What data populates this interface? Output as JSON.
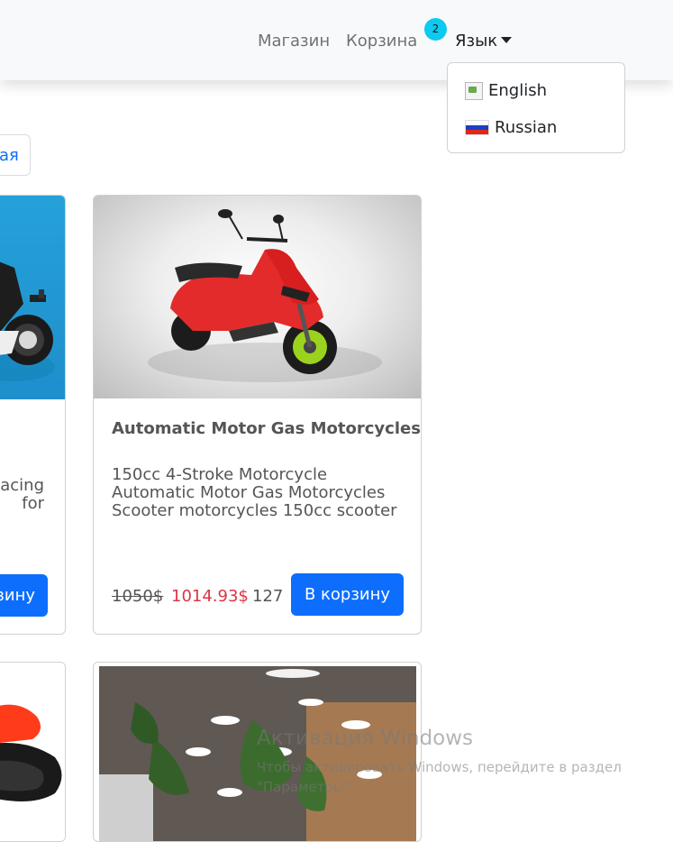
{
  "navbar": {
    "shop_label": "Магазин",
    "cart_label": "Корзина",
    "cart_count": "2",
    "language_label": "Язык"
  },
  "language_menu": {
    "items": [
      {
        "label": "English",
        "icon": "broken-image-icon"
      },
      {
        "label": "Russian",
        "icon": "russia-flag-icon"
      }
    ]
  },
  "category_button": {
    "label": "ая"
  },
  "products": [
    {
      "title": "",
      "description_visible": "acing\nfor",
      "buy_label": "зину"
    },
    {
      "title": "Automatic Motor Gas Motorcycles",
      "description": "150cc 4-Stroke Motorcycle Automatic Motor Gas Motorcycles Scooter motorcycles 150cc scooter",
      "old_price": "1050$",
      "new_price": "1014.93$",
      "stock": "127",
      "buy_label": "В корзину"
    }
  ],
  "watermark": {
    "title": "Активация Windows",
    "line1": "Чтобы активировать Windows, перейдите в раздел",
    "line2": "\"Параметры\"."
  },
  "colors": {
    "primary": "#0d6efd",
    "badge": "#0dcaf0",
    "sale": "#dc3545",
    "navbar_bg": "#f8f9fa"
  }
}
